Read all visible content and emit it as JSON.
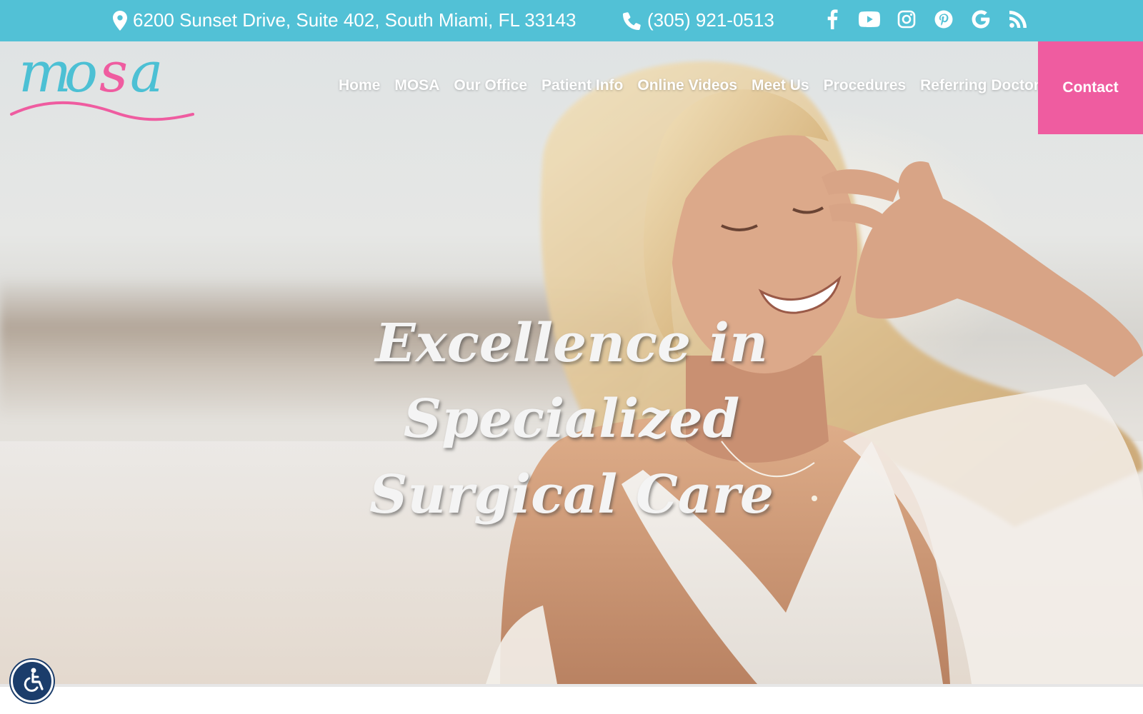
{
  "topbar": {
    "address": "6200 Sunset Drive, Suite 402, South Miami, FL 33143",
    "phone": "(305) 921-0513",
    "social_icons": [
      "facebook-icon",
      "youtube-icon",
      "instagram-icon",
      "pinterest-icon",
      "google-icon",
      "rss-icon"
    ]
  },
  "header": {
    "logo_text": "mosa",
    "nav": [
      {
        "label": "Home"
      },
      {
        "label": "MOSA"
      },
      {
        "label": "Our Office"
      },
      {
        "label": "Patient Info"
      },
      {
        "label": "Online Videos"
      },
      {
        "label": "Meet Us"
      },
      {
        "label": "Procedures"
      },
      {
        "label": "Referring Doctors"
      }
    ],
    "contact_label": "Contact"
  },
  "hero": {
    "headline_line1": "Excellence in Specialized",
    "headline_line2": "Surgical Care"
  },
  "accessibility": {
    "icon": "accessibility-icon"
  },
  "colors": {
    "topbar_bg": "#52c1d6",
    "accent_pink": "#ef5ca0",
    "logo_teal": "#4cc0d4",
    "access_navy": "#1b3d6b"
  }
}
